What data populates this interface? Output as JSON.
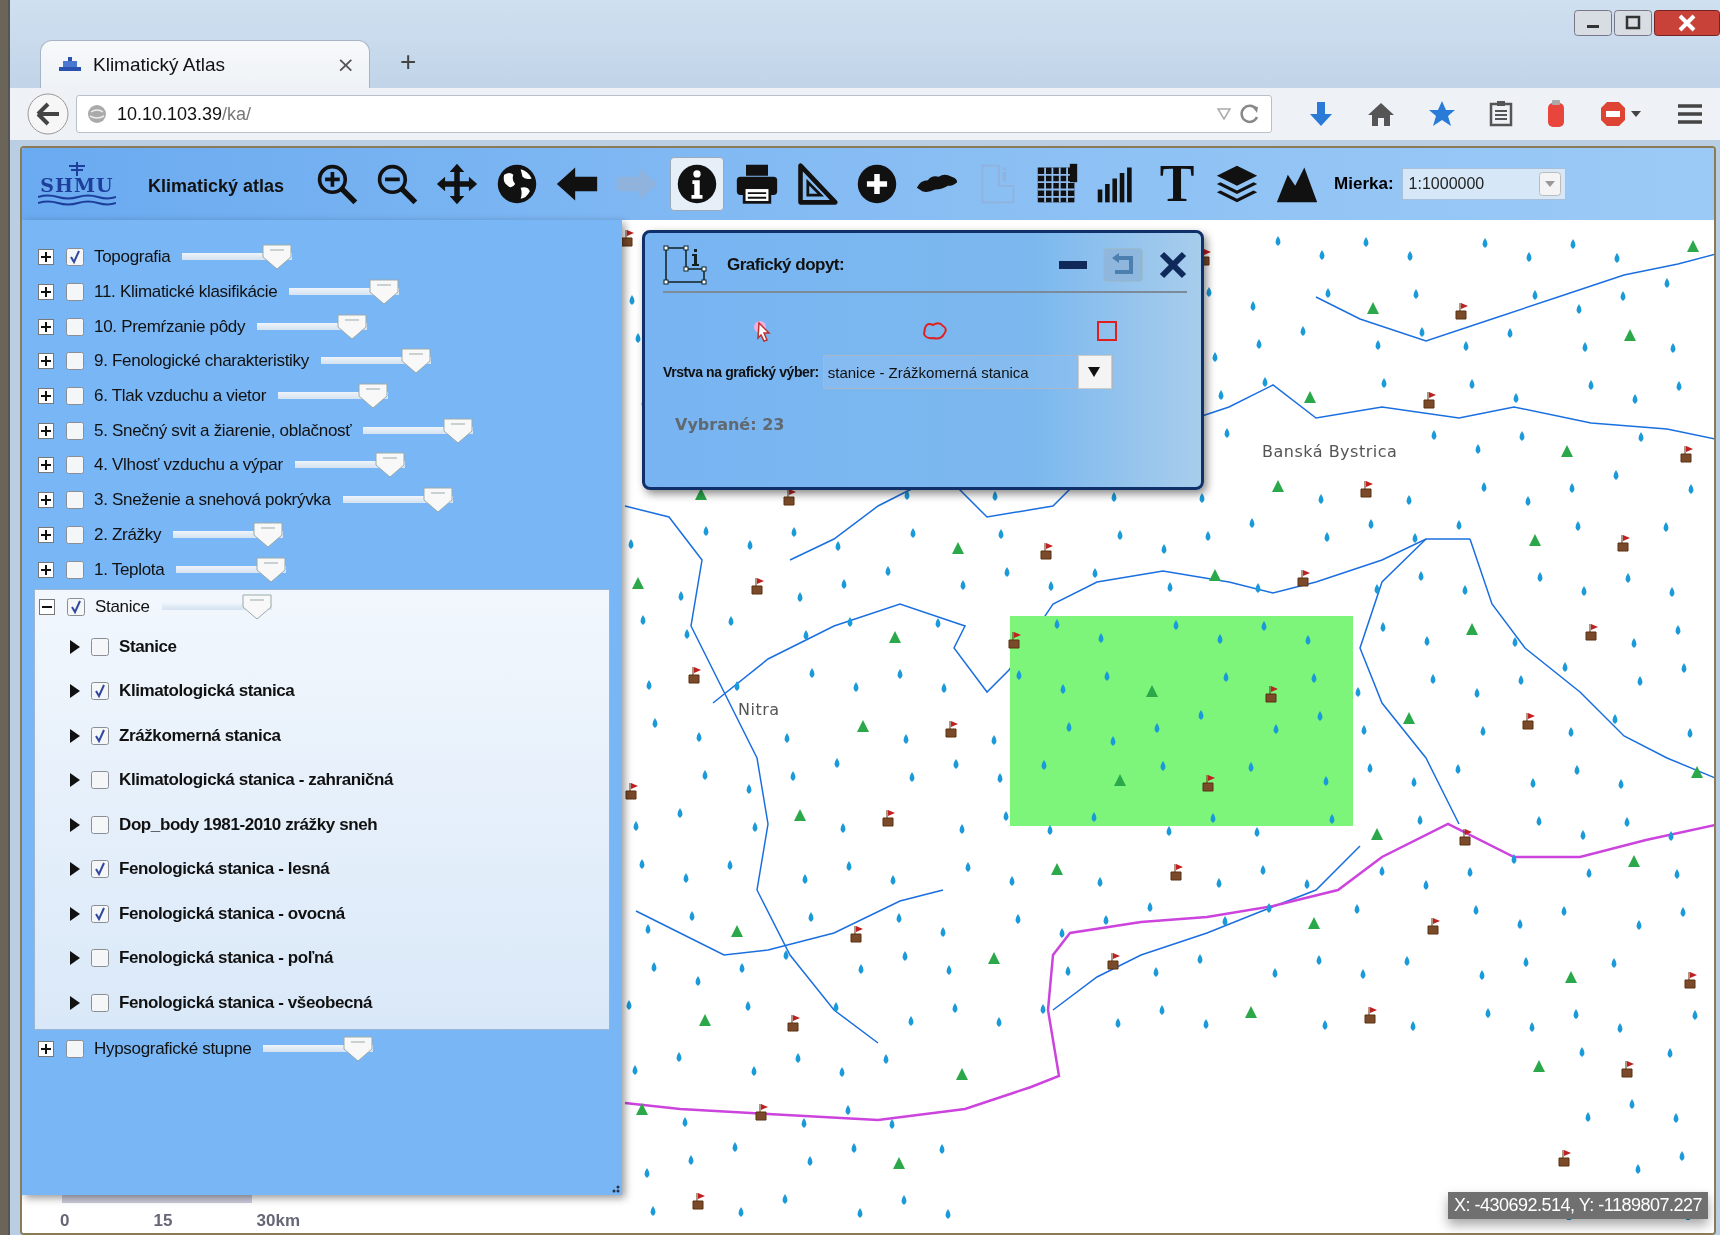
{
  "browser": {
    "tab_title": "Klimatický Atlas",
    "tab_close": "×",
    "new_tab": "+",
    "url_host": "10.10.103.39",
    "url_path": "/ka/"
  },
  "toolbar": {
    "logo_text": "SHMU",
    "title": "Klimatický atlas",
    "tools": [
      {
        "kind": "zoom-in",
        "selected": false,
        "disabled": false
      },
      {
        "kind": "zoom-out",
        "selected": false,
        "disabled": false
      },
      {
        "kind": "pan",
        "selected": false,
        "disabled": false
      },
      {
        "kind": "globe",
        "selected": false,
        "disabled": false
      },
      {
        "kind": "back",
        "selected": false,
        "disabled": false
      },
      {
        "kind": "forward",
        "selected": false,
        "disabled": true
      },
      {
        "kind": "info",
        "selected": true,
        "disabled": false
      },
      {
        "kind": "print",
        "selected": false,
        "disabled": false
      },
      {
        "kind": "measure",
        "selected": false,
        "disabled": false
      },
      {
        "kind": "add",
        "selected": false,
        "disabled": false
      },
      {
        "kind": "country",
        "selected": false,
        "disabled": false
      },
      {
        "kind": "query",
        "selected": false,
        "disabled": true
      },
      {
        "kind": "table",
        "selected": false,
        "disabled": false
      },
      {
        "kind": "chart",
        "selected": false,
        "disabled": false
      },
      {
        "kind": "text",
        "glyph": "T",
        "selected": false,
        "disabled": false
      },
      {
        "kind": "layers",
        "selected": false,
        "disabled": false
      },
      {
        "kind": "terrain",
        "selected": false,
        "disabled": false
      }
    ],
    "scale_label": "Mierka:",
    "scale_value": "1:1000000"
  },
  "layers": [
    {
      "name": "Topografia",
      "checked": true,
      "expanded": false,
      "level": 1
    },
    {
      "name": "11. Klimatické klasifikácie",
      "checked": false,
      "expanded": false,
      "level": 1
    },
    {
      "name": "10. Premŕzanie pôdy",
      "checked": false,
      "expanded": false,
      "level": 1
    },
    {
      "name": "9. Fenologické charakteristiky",
      "checked": false,
      "expanded": false,
      "level": 1
    },
    {
      "name": "6. Tlak vzduchu a vietor",
      "checked": false,
      "expanded": false,
      "level": 1
    },
    {
      "name": "5. Snečný svit a žiarenie, oblačnosť",
      "checked": false,
      "expanded": false,
      "level": 1
    },
    {
      "name": "4. Vlhosť vzduchu a výpar",
      "checked": false,
      "expanded": false,
      "level": 1
    },
    {
      "name": "3. Sneženie a snehová pokrývka",
      "checked": false,
      "expanded": false,
      "level": 1
    },
    {
      "name": "2. Zrážky",
      "checked": false,
      "expanded": false,
      "level": 1
    },
    {
      "name": "1. Teplota",
      "checked": false,
      "expanded": false,
      "level": 1
    },
    {
      "name": "Stanice",
      "checked": true,
      "expanded": true,
      "level": 1,
      "children": [
        {
          "name": "Stanice",
          "checked": false,
          "expanded": false
        },
        {
          "name": "Klimatologická stanica",
          "checked": true,
          "expanded": false
        },
        {
          "name": "Zrážkomerná stanica",
          "checked": true,
          "expanded": false
        },
        {
          "name": "Klimatologická stanica - zahraničná",
          "checked": false,
          "expanded": false
        },
        {
          "name": "Dop_body 1981-2010 zrážky sneh",
          "checked": false,
          "expanded": false
        },
        {
          "name": "Fenologická stanica - lesná",
          "checked": true,
          "expanded": false
        },
        {
          "name": "Fenologická stanica - ovocná",
          "checked": true,
          "expanded": false
        },
        {
          "name": "Fenologická stanica - poľná",
          "checked": false,
          "expanded": false
        },
        {
          "name": "Fenologická stanica - všeobecná",
          "checked": false,
          "expanded": false
        }
      ]
    },
    {
      "name": "Hypsografické stupne",
      "checked": false,
      "expanded": false,
      "level": 1
    }
  ],
  "dialog": {
    "title": "Grafický dopyt:",
    "layer_label": "Vrstva na grafický výber:",
    "layer_value": "stanice - Zrážkomerná stanica",
    "selected_count": "Vybrané: 23"
  },
  "map": {
    "places": [
      {
        "name": "Nitra"
      },
      {
        "name": "Banská Bystrica"
      }
    ],
    "scale_labels": [
      "0",
      "15",
      "30km"
    ],
    "coordinates": "X: -430692.514, Y: -1189807.227"
  }
}
